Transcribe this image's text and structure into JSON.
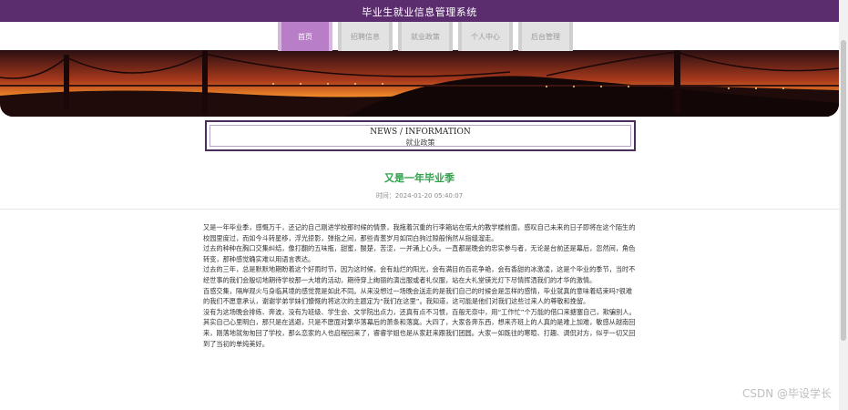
{
  "header": {
    "title": "毕业生就业信息管理系统"
  },
  "nav": {
    "tabs": [
      {
        "label": "首页",
        "active": true
      },
      {
        "label": "招聘信息",
        "active": false
      },
      {
        "label": "就业政策",
        "active": false
      },
      {
        "label": "个人中心",
        "active": false
      },
      {
        "label": "后台管理",
        "active": false
      }
    ]
  },
  "section": {
    "title_en": "NEWS / INFORMATION",
    "title_cn": "就业政策"
  },
  "article": {
    "title": "又是一年毕业季",
    "time": "时间：2024-01-20 05:40:07",
    "paragraphs": [
      "又是一年毕业季，感慨万千，还记的自己刚进学校那时候的情景，我拖着沉重的行李箱站在偌大的教学楼前面，感叹自己未来的日子即将在这个陌生的校园里度过，而如今斗转星移，浮光掠影，弹指之间，那些青葱岁月如同白驹过隙般悄然从指缝溜走。",
      "过去的种种在胸口交集纠结，像打翻的五味瓶，甜蜜，酸楚，苦涩，一并涌上心头。一直都是晚会的忠实参与者，无论是台前还是幕后，忽然间，角色转变，那种感觉确实难以用语言表达。",
      "过去的三年，总是默默地期盼着这个好雨时节，因为这时候，会有灿烂的阳光，会有满目的百花争艳，会有香甜的冰激凌，这是个毕业的季节，当时不经世事的我们会殷切地期待学校那一大堆的活动，期待穿上绚丽的演出服或者礼仪服，站在大礼堂镁光灯下尽情挥洒我们的才华的激情。",
      "百感交集，隔岸观火与身临其境的感觉竟是如此不同。从来没想过一场晚会送走的是我们自己的时候会是怎样的感情，毕业就真的意味着结束吗?很难的我们不愿意承认，谢谢学弟学妹们慷慨的将这次的主题定为“我们在这里”。我知道，这可能是他们对我们这些过来人的尊敬和挽留。",
      "没有为这场晚会排练、奔波，没有为班级、学生会、文学院出点力，还真有点不习惯，百般无奈中，用“工作忙”个万能的借口来搪塞自己，欺骗别人。其实自己心里明白，那只是在逃避，只是不愿面对繁华落幕后的萧条和落寞。大四了，大家各奔东西，想来齐班上的人真的是难上加难，敏感从越南回来，刚落地就匆匆回了学校，那么恋家的人也启程回来了，睿睿学姐也是从家赶来跟我们团圆。大家一如既往的寒暄、打趣、调侃对方，似乎一切又回到了当初的单纯美好。"
    ]
  },
  "watermark": "CSDN @毕设学长",
  "colors": {
    "topbar": "#5b2d6e",
    "active_tab": "#b87fc8",
    "title_green": "#2fa24a"
  }
}
